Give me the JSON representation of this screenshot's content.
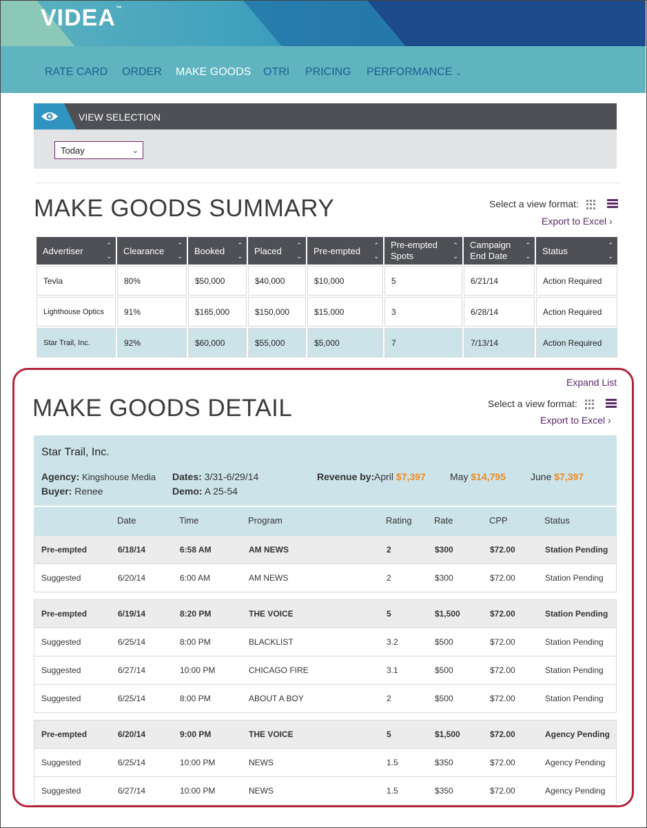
{
  "brand": {
    "logo_text": "VIDEA"
  },
  "nav": {
    "items": [
      {
        "label": "RATE CARD"
      },
      {
        "label": "ORDER"
      },
      {
        "label": "MAKE GOODS",
        "active": true
      },
      {
        "label": "OTRI"
      },
      {
        "label": "PRICING"
      },
      {
        "label": "PERFORMANCE"
      }
    ]
  },
  "view_selection": {
    "title": "VIEW SELECTION",
    "selected": "Today"
  },
  "summary": {
    "title": "MAKE GOODS SUMMARY",
    "format_label": "Select a view format:",
    "export_label": "Export to Excel",
    "columns": [
      "Advertiser",
      "Clearance",
      "Booked",
      "Placed",
      "Pre-empted",
      "Pre-empted Spots",
      "Campaign End Date",
      "Status"
    ],
    "rows": [
      [
        "Tevla",
        "80%",
        "$50,000",
        "$40,000",
        "$10,000",
        "5",
        "6/21/14",
        "Action Required"
      ],
      [
        "Lighthouse Optics",
        "91%",
        "$165,000",
        "$150,000",
        "$15,000",
        "3",
        "6/28/14",
        "Action Required"
      ],
      [
        "Star Trail, Inc.",
        "92%",
        "$60,000",
        "$55,000",
        "$5,000",
        "7",
        "7/13/14",
        "Action Required"
      ]
    ],
    "selected_row": 2
  },
  "detail": {
    "expand_label": "Expand List",
    "title": "MAKE GOODS DETAIL",
    "format_label": "Select a view format:",
    "export_label": "Export to Excel",
    "advertiser": "Star Trail, Inc.",
    "agency_label": "Agency:",
    "agency": "Kingshouse Media",
    "buyer_label": "Buyer:",
    "buyer": "Renee",
    "dates_label": "Dates:",
    "dates": "3/31-6/29/14",
    "demo_label": "Demo:",
    "demo": "A 25-54",
    "revenue_label": "Revenue by:",
    "revenue": [
      {
        "month": "April",
        "amount": "$7,397"
      },
      {
        "month": "May",
        "amount": "$14,795"
      },
      {
        "month": "June",
        "amount": "$7,397"
      }
    ],
    "columns": [
      "",
      "Date",
      "Time",
      "Program",
      "Rating",
      "Rate",
      "CPP",
      "Status"
    ],
    "groups": [
      [
        [
          "Pre-empted",
          "6/18/14",
          "6:58 AM",
          "AM NEWS",
          "2",
          "$300",
          "$72.00",
          "Station Pending"
        ],
        [
          "Suggested",
          "6/20/14",
          "6:00 AM",
          "AM NEWS",
          "2",
          "$300",
          "$72.00",
          "Station Pending"
        ]
      ],
      [
        [
          "Pre-empted",
          "6/19/14",
          "8:20 PM",
          "THE VOICE",
          "5",
          "$1,500",
          "$72.00",
          "Station Pending"
        ],
        [
          "Suggested",
          "6/25/14",
          "8:00 PM",
          "BLACKLIST",
          "3.2",
          "$500",
          "$72.00",
          "Station Pending"
        ],
        [
          "Suggested",
          "6/27/14",
          "10:00 PM",
          "CHICAGO FIRE",
          "3.1",
          "$500",
          "$72.00",
          "Station Pending"
        ],
        [
          "Suggested",
          "6/25/14",
          "8:00 PM",
          "ABOUT A BOY",
          "2",
          "$500",
          "$72.00",
          "Station Pending"
        ]
      ],
      [
        [
          "Pre-empted",
          "6/20/14",
          "9:00 PM",
          "THE VOICE",
          "5",
          "$1,500",
          "$72.00",
          "Agency Pending"
        ],
        [
          "Suggested",
          "6/25/14",
          "10:00 PM",
          "NEWS",
          "1.5",
          "$350",
          "$72.00",
          "Agency Pending"
        ],
        [
          "Suggested",
          "6/27/14",
          "10:00 PM",
          "NEWS",
          "1.5",
          "$350",
          "$72.00",
          "Agency Pending"
        ]
      ]
    ]
  }
}
